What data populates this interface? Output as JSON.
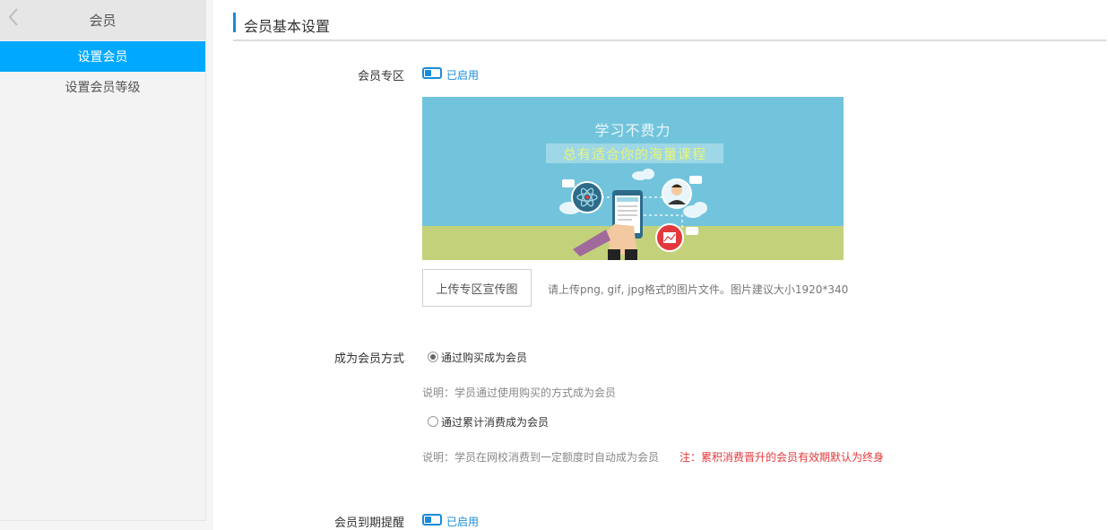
{
  "sidebar": {
    "title": "会员",
    "items": [
      {
        "label": "设置会员",
        "active": true
      },
      {
        "label": "设置会员等级",
        "active": false
      }
    ]
  },
  "section": {
    "title": "会员基本设置"
  },
  "zone": {
    "label": "会员专区",
    "status": "已启用",
    "banner": {
      "line1": "学习不费力",
      "line2": "总有适合你的海量课程"
    },
    "upload_button": "上传专区宣传图",
    "upload_hint": "请上传png, gif, jpg格式的图片文件。图片建议大小1920*340"
  },
  "membership": {
    "label": "成为会员方式",
    "options": [
      {
        "label": "通过购买成为会员",
        "checked": true,
        "desc": "说明：学员通过使用购买的方式成为会员"
      },
      {
        "label": "通过累计消费成为会员",
        "checked": false,
        "desc": "说明：学员在网校消费到一定额度时自动成为会员",
        "warning": "注：累积消费晋升的会员有效期默认为终身"
      }
    ]
  },
  "expiry": {
    "label": "会员到期提醒",
    "status": "已启用"
  },
  "colors": {
    "accent": "#00a9ff",
    "toggle": "#1a8bd8",
    "warning": "#e4393c",
    "banner_sky": "#72c4dc",
    "banner_ground": "#c3d27a"
  }
}
